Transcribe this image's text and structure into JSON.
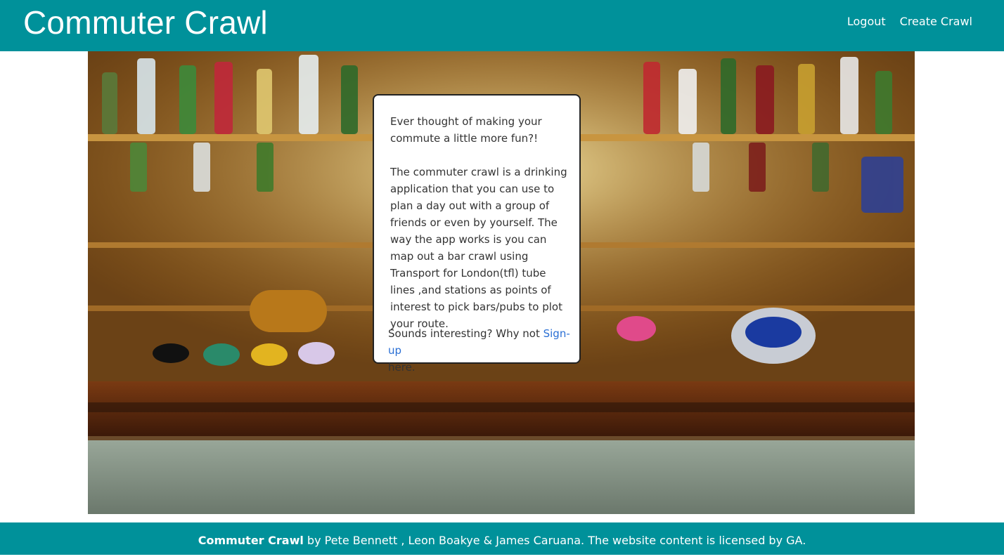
{
  "navbar": {
    "brand": "Commuter Crawl",
    "links": [
      "Logout",
      "Create Crawl"
    ]
  },
  "hero": {
    "image_description_icon": "bar-photo"
  },
  "info_card": {
    "intro": "Ever thought of making your commute a little more fun?!",
    "body": "The commuter crawl is a drinking application that you can use to plan a day out with a group of friends or even by yourself. The way the app works is you can map out a bar crawl using Transport for London(tfl) tube lines ,and stations as points of interest to pick bars/pubs to plot your route.",
    "cta_prefix": "Sounds interesting? Why not ",
    "cta_link": "Sign-up",
    "cta_suffix": "here."
  },
  "footer": {
    "brand": "Commuter Crawl",
    "text": " by Pete Bennett , Leon Boakye & James Caruana. The website content is licensed by GA."
  },
  "colors": {
    "navbar_bg": "#00919a",
    "footer_bg": "#00919a",
    "link": "#2a6fd4"
  }
}
